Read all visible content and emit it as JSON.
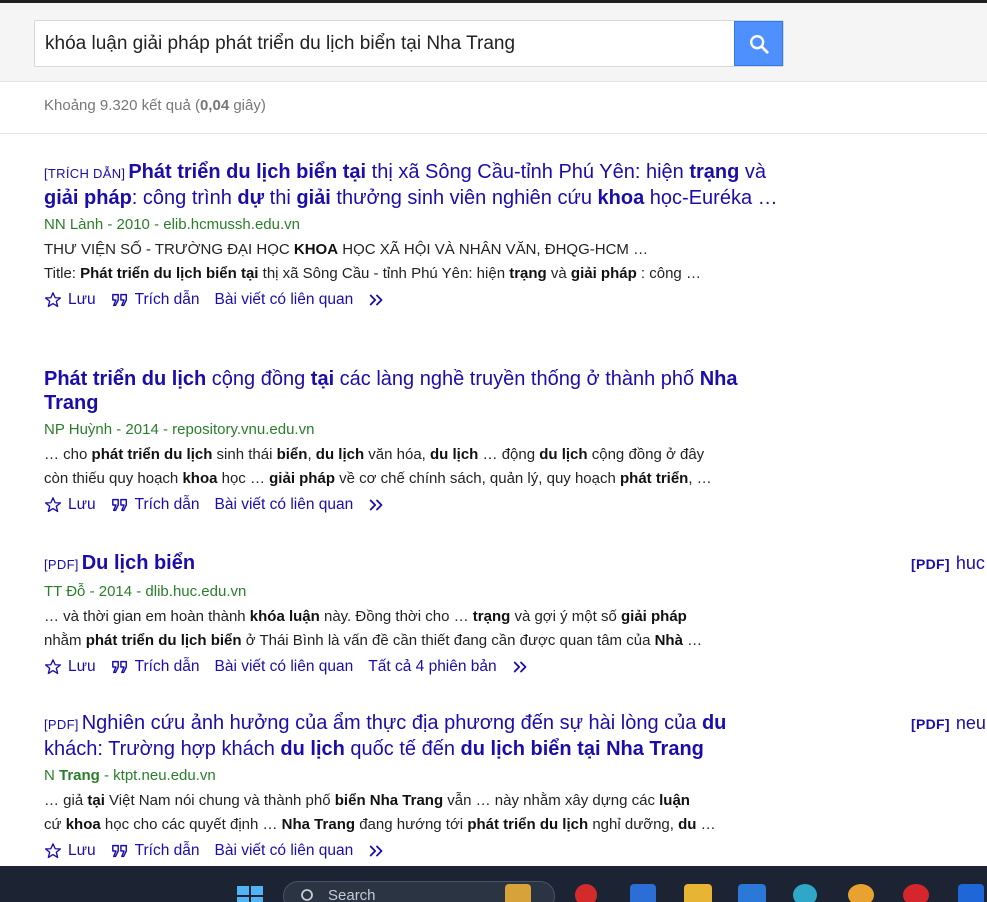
{
  "search": {
    "query": "khóa luận giải pháp phát triển du lịch biển tại Nha Trang",
    "button_icon": "search-icon"
  },
  "stats": {
    "prefix": "Khoảng 9.320 kết quả (",
    "time": "0,04",
    "suffix": " giây)"
  },
  "results": [
    {
      "tag": "[TRÍCH DẪN]",
      "title_html": "<b>Phát triển du lịch biển tại</b> thị xã Sông Cầu-tỉnh Phú Yên: hiện <b>trạng</b> và <b>giải pháp</b>: công trình <b>dự</b> thi <b>giải</b> thưởng sinh viên nghiên cứu <b>khoa</b> học-Euréka …",
      "meta": "NN Lành - 2010 - elib.hcmussh.edu.vn",
      "snippets": [
        "THƯ VIỆN SỐ - TRƯỜNG ĐẠI HỌC <b>KHOA</b> HỌC XÃ HỘI VÀ NHÂN VĂN, ĐHQG-HCM …",
        "Title: <b>Phát triển du lịch biển tại</b> thị xã Sông Cầu - tỉnh Phú Yên: hiện <b>trạng</b> và <b>giải pháp</b> : công …"
      ],
      "actions": [
        "Lưu",
        "Trích dẫn",
        "Bài viết có liên quan"
      ]
    },
    {
      "tag": "",
      "title_html": "<b>Phát triển du lịch</b> cộng đồng <b>tại</b> các làng nghề truyền thống ở thành phố <b>Nha Trang</b>",
      "meta": "NP Huỳnh - 2014 - repository.vnu.edu.vn",
      "snippets": [
        "… cho <b>phát triển du lịch</b> sinh thái <b>biển</b>, <b>du lịch</b> văn hóa, <b>du lịch</b> … động <b>du lịch</b> cộng đồng ở đây",
        "còn thiếu quy hoạch <b>khoa</b> học … <b>giải pháp</b> về cơ chế chính sách, quản lý, quy hoạch <b>phát triển</b>, …"
      ],
      "actions": [
        "Lưu",
        "Trích dẫn",
        "Bài viết có liên quan"
      ]
    },
    {
      "tag": "[PDF]",
      "title_html": "<b>Du lịch biển</b>",
      "meta": "TT Đỗ - 2014 - dlib.huc.edu.vn",
      "snippets": [
        "… và thời gian em hoàn thành <b>khóa luận</b> này. Đồng thời cho … <b>trạng</b> và gợi ý một số <b>giải pháp</b>",
        "nhằm <b>phát triển du lịch biển</b> ở Thái Bình là vấn đề cần thiết đang cần được quan tâm của <b>Nhà</b> …"
      ],
      "actions": [
        "Lưu",
        "Trích dẫn",
        "Bài viết có liên quan",
        "Tất cả 4 phiên bản"
      ]
    },
    {
      "tag": "[PDF]",
      "title_html": "Nghiên cứu ảnh hưởng của ẩm thực địa phương đến sự hài lòng của <b>du</b> khách: Trường hợp khách <b>du lịch</b> quốc tế đến <b>du lịch biển tại Nha Trang</b>",
      "meta_html": "N <b>Trang</b> - ktpt.neu.edu.vn",
      "snippets": [
        "… giả <b>tại</b> Việt Nam nói chung và thành phố <b>biển Nha Trang</b> vẫn … này nhằm xây dựng các <b>luận</b>",
        "cứ <b>khoa</b> học cho các quyết định … <b>Nha Trang</b> đang hướng tới <b>phát triển du lịch</b> nghỉ dưỡng, <b>du</b> …"
      ],
      "actions": [
        "Lưu",
        "Trích dẫn",
        "Bài viết có liên quan"
      ]
    }
  ],
  "side_links": [
    {
      "tag": "[PDF]",
      "text": "huc"
    },
    {
      "tag": "[PDF]",
      "text": "neu"
    }
  ],
  "taskbar": {
    "search_text": "Search"
  },
  "colors": {
    "link": "#1a0dab",
    "meta": "#2a7e2a",
    "search_button": "#4d90fe",
    "taskbar": "#1c2433"
  }
}
